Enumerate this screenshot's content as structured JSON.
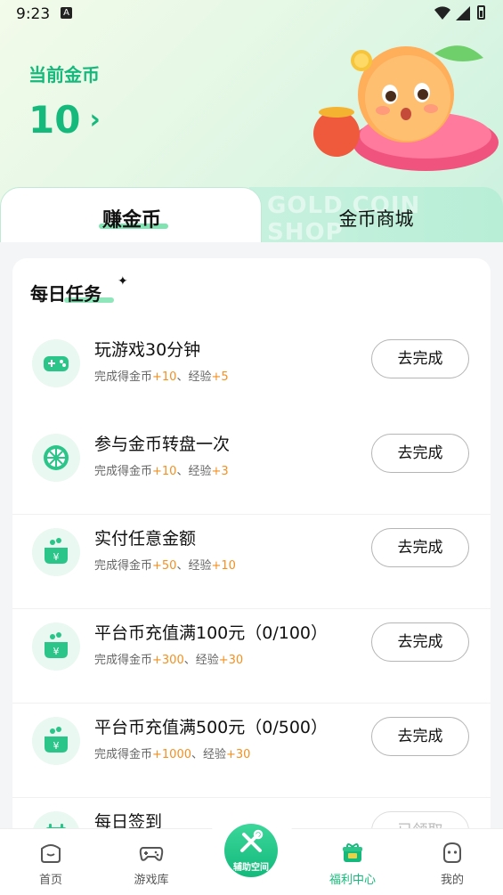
{
  "status_bar": {
    "time": "9:23",
    "notification_badge": "A"
  },
  "wallet": {
    "label": "当前金币",
    "value": "10",
    "arrow": "›"
  },
  "tabs": {
    "earn": "赚金币",
    "shop": "金币商城",
    "shop_watermark": "GOLD COIN SHOP"
  },
  "daily_tasks": {
    "title": "每日任务",
    "items": [
      {
        "icon": "gamepad-icon",
        "title": "玩游戏30分钟",
        "reward_prefix": "完成得金币",
        "coins": "+10",
        "exp_prefix": "、经验",
        "exp": "+5",
        "button": "去完成"
      },
      {
        "icon": "wheel-icon",
        "title": "参与金币转盘一次",
        "reward_prefix": "完成得金币",
        "coins": "+10",
        "exp_prefix": "、经验",
        "exp": "+3",
        "button": "去完成"
      },
      {
        "icon": "money-bag-icon",
        "title": "实付任意金额",
        "reward_prefix": "完成得金币",
        "coins": "+50",
        "exp_prefix": "、经验",
        "exp": "+10",
        "button": "去完成"
      },
      {
        "icon": "money-bag-icon",
        "title": "平台币充值满100元（0/100）",
        "reward_prefix": "完成得金币",
        "coins": "+300",
        "exp_prefix": "、经验",
        "exp": "+30",
        "button": "去完成"
      },
      {
        "icon": "money-bag-icon",
        "title": "平台币充值满500元（0/500）",
        "reward_prefix": "完成得金币",
        "coins": "+1000",
        "exp_prefix": "、经验",
        "exp": "+30",
        "button": "去完成"
      },
      {
        "icon": "calendar-icon",
        "title": "每日签到",
        "button": "已领取"
      }
    ]
  },
  "bottom_nav": {
    "home": "首页",
    "games": "游戏库",
    "center": "辅助空间",
    "welfare": "福利中心",
    "mine": "我的",
    "active": "welfare"
  },
  "colors": {
    "accent": "#14b97b",
    "orange": "#f3901f"
  }
}
